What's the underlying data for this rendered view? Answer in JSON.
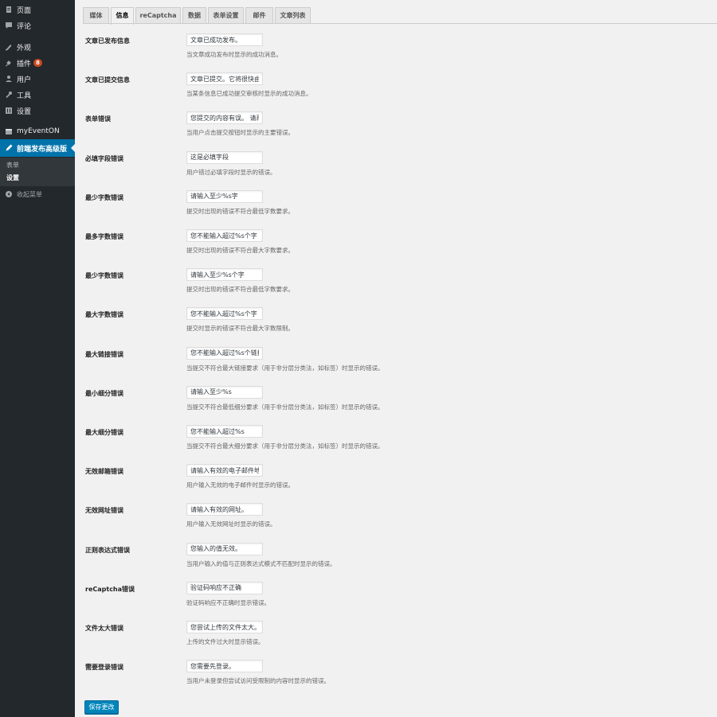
{
  "sidebar": {
    "items": [
      {
        "label": "页面",
        "icon": "pages-icon"
      },
      {
        "label": "评论",
        "icon": "comments-icon"
      },
      {
        "label": "外观",
        "icon": "appearance-icon"
      },
      {
        "label": "插件",
        "icon": "plugins-icon",
        "badge": "8"
      },
      {
        "label": "用户",
        "icon": "users-icon"
      },
      {
        "label": "工具",
        "icon": "tools-icon"
      },
      {
        "label": "设置",
        "icon": "settings-icon"
      },
      {
        "label": "myEventON",
        "icon": "calendar-icon"
      },
      {
        "label": "前端发布高级版",
        "icon": "pen-icon"
      }
    ],
    "submenu": [
      "表单",
      "设置"
    ],
    "collapse_label": "收起菜单",
    "accent_color": "#0073aa",
    "badge_color": "#ca4a1f"
  },
  "tabs": [
    "媒体",
    "信息",
    "reCaptcha",
    "数据",
    "表单设置",
    "邮件",
    "文章列表"
  ],
  "active_tab": "信息",
  "fields": [
    {
      "label": "文章已发布信息",
      "value": "文章已成功发布。",
      "description": "当文章成功发布时显示的成功消息。"
    },
    {
      "label": "文章已提交信息",
      "value": "文章已提交。它将很快由",
      "description": "当某条信息已成功提交审核时显示的成功消息。"
    },
    {
      "label": "表单错误",
      "value": "您提交的内容有误。 请再",
      "description": "当用户点击提交按钮时显示的主要错误。"
    },
    {
      "label": "必填字段错误",
      "value": "这是必填字段",
      "description": "用户错过必填字段时显示的错误。"
    },
    {
      "label": "最少字数错误",
      "value": "请输入至少%s字",
      "description": "提交时出现的错误不符合最低字数要求。"
    },
    {
      "label": "最多字数错误",
      "value": "您不能输入超过%s个字",
      "description": "提交时出现的错误不符合最大字数要求。"
    },
    {
      "label": "最少字数错误",
      "value": "请输入至少%s个字",
      "description": "提交时出现的错误不符合最低字数要求。"
    },
    {
      "label": "最大字数错误",
      "value": "您不能输入超过%s个字",
      "description": "提交时显示的错误不符合最大字数限制。"
    },
    {
      "label": "最大链接错误",
      "value": "您不能输入超过%s个链接",
      "description": "当提交不符合最大链接要求（用于非分层分类法，如标签）时显示的错误。"
    },
    {
      "label": "最小细分错误",
      "value": "请输入至少%s",
      "description": "当提交不符合最低细分要求（用于非分层分类法，如标签）时显示的错误。"
    },
    {
      "label": "最大细分错误",
      "value": "您不能输入超过%s",
      "description": "当提交不符合最大细分要求（用于非分层分类法，如标签）时显示的错误。"
    },
    {
      "label": "无效邮箱错误",
      "value": "请输入有效的电子邮件地",
      "description": "用户输入无效的电子邮件时显示的错误。"
    },
    {
      "label": "无效网址错误",
      "value": "请输入有效的网址。",
      "description": "用户输入无效网址时显示的错误。"
    },
    {
      "label": "正则表达式错误",
      "value": "您输入的值无效。",
      "description": "当用户输入的值与正则表达式模式不匹配时显示的错误。"
    },
    {
      "label": "reCaptcha错误",
      "value": "验证码响应不正确",
      "description": "验证码响应不正确时显示错误。"
    },
    {
      "label": "文件太大错误",
      "value": "您尝试上传的文件太大。",
      "description": "上传的文件过大时显示错误。"
    },
    {
      "label": "需要登录错误",
      "value": "您需要先登录。",
      "description": "当用户未登录但尝试访问受限制的内容时显示的错误。"
    }
  ],
  "save_button": "保存更改"
}
